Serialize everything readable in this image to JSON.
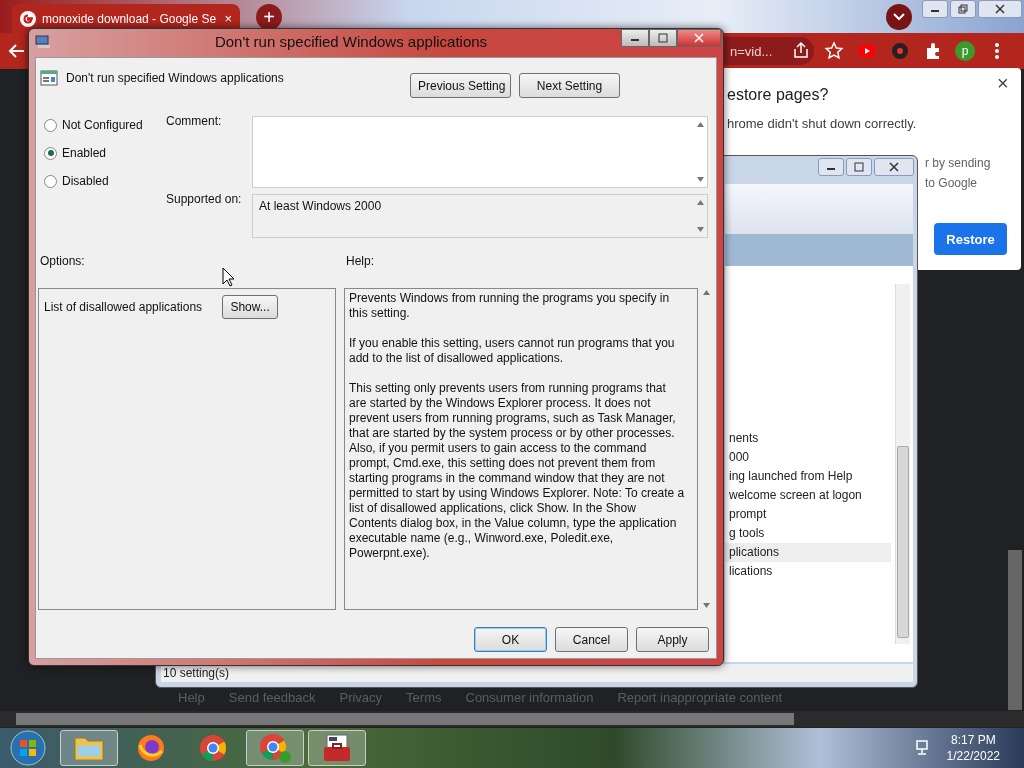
{
  "browser": {
    "tab": {
      "title": "monoxide download - Google Se",
      "close": "×"
    },
    "new_tab": "+",
    "address_fragment": "n=vid...",
    "profile": "p",
    "restore_popup": {
      "title": "estore pages?",
      "message": "hrome didn't shut down correctly.",
      "note_lines": [
        "r by sending",
        "to Google"
      ],
      "close": "×",
      "button": "Restore"
    },
    "footer_links": [
      "Help",
      "Send feedback",
      "Privacy",
      "Terms",
      "Consumer information",
      "Report inappropriate content"
    ]
  },
  "background_window": {
    "items": [
      {
        "label": "nents",
        "selected": false
      },
      {
        "label": "000",
        "selected": false
      },
      {
        "label": "ing launched from Help",
        "selected": false
      },
      {
        "label": "welcome screen at logon",
        "selected": false
      },
      {
        "label": "prompt",
        "selected": false
      },
      {
        "label": "g tools",
        "selected": false
      },
      {
        "label": "plications",
        "selected": true
      },
      {
        "label": "lications",
        "selected": false
      }
    ],
    "status": "10 setting(s)"
  },
  "dialog": {
    "title": "Don't run specified Windows applications",
    "heading": "Don't run specified Windows applications",
    "nav_buttons": [
      "Previous Setting",
      "Next Setting"
    ],
    "radios": [
      {
        "label": "Not Configured",
        "selected": false
      },
      {
        "label": "Enabled",
        "selected": true
      },
      {
        "label": "Disabled",
        "selected": false
      }
    ],
    "comment_label": "Comment:",
    "supported_label": "Supported on:",
    "supported_value": "At least Windows 2000",
    "options_label": "Options:",
    "help_label": "Help:",
    "option": {
      "label": "List of disallowed applications",
      "button": "Show..."
    },
    "help_paragraphs": [
      "Prevents Windows from running the programs you specify in this setting.",
      "If you enable this setting, users cannot run programs that you add to the list of disallowed applications.",
      "This setting only prevents users from running programs that are started by the Windows Explorer process. It does not prevent users from running programs, such as Task Manager, that are started by the system process or by other processes. Also, if you permit users to gain access to the command prompt, Cmd.exe, this setting does not prevent them from starting programs in the command window that they are not permitted to start by using Windows Explorer. Note: To create a list of disallowed applications, click Show. In the Show Contents dialog box, in the Value column, type the application executable name (e.g., Winword.exe, Poledit.exe, Powerpnt.exe)."
    ],
    "buttons": [
      "OK",
      "Cancel",
      "Apply"
    ]
  },
  "taskbar": {
    "apps": [
      {
        "kind": "explorer",
        "active": true
      },
      {
        "kind": "firefox",
        "active": false
      },
      {
        "kind": "chrome",
        "active": false
      },
      {
        "kind": "chrome-profile",
        "active": true
      },
      {
        "kind": "toolbox",
        "active": true
      }
    ],
    "time": "8:17 PM",
    "date": "1/22/2022"
  }
}
